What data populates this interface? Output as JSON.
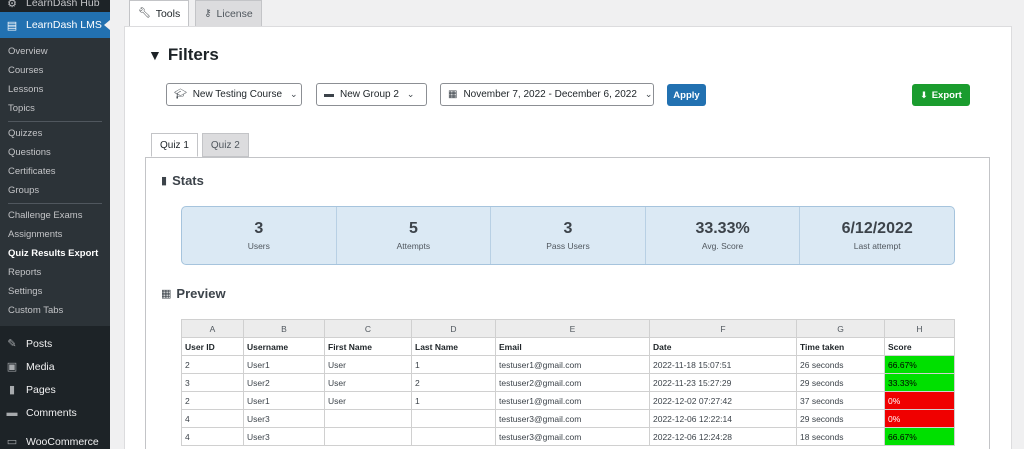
{
  "sidebar": {
    "hub_label": "LearnDash Hub",
    "current_label": "LearnDash LMS",
    "submenu": [
      {
        "label": "Overview"
      },
      {
        "label": "Courses"
      },
      {
        "label": "Lessons"
      },
      {
        "label": "Topics"
      },
      {
        "label": "Quizzes"
      },
      {
        "label": "Questions"
      },
      {
        "label": "Certificates"
      },
      {
        "label": "Groups"
      },
      {
        "label": "Challenge Exams"
      },
      {
        "label": "Assignments"
      },
      {
        "label": "Quiz Results Export"
      },
      {
        "label": "Reports"
      },
      {
        "label": "Settings"
      },
      {
        "label": "Custom Tabs"
      }
    ],
    "main_items": [
      {
        "label": "Posts"
      },
      {
        "label": "Media"
      },
      {
        "label": "Pages"
      },
      {
        "label": "Comments"
      },
      {
        "label": "WooCommerce"
      }
    ]
  },
  "top_tabs": [
    {
      "label": "Tools"
    },
    {
      "label": "License"
    }
  ],
  "filters": {
    "title": "Filters",
    "course": "New Testing Course",
    "group": "New Group 2",
    "date_range": "November 7, 2022 - December 6, 2022",
    "apply_label": "Apply",
    "export_label": "Export"
  },
  "quiz_tabs": [
    {
      "label": "Quiz 1"
    },
    {
      "label": "Quiz 2"
    }
  ],
  "stats": {
    "title": "Stats",
    "items": [
      {
        "value": "3",
        "label": "Users"
      },
      {
        "value": "5",
        "label": "Attempts"
      },
      {
        "value": "3",
        "label": "Pass Users"
      },
      {
        "value": "33.33%",
        "label": "Avg. Score"
      },
      {
        "value": "6/12/2022",
        "label": "Last attempt"
      }
    ]
  },
  "preview": {
    "title": "Preview",
    "column_letters": [
      "A",
      "B",
      "C",
      "D",
      "E",
      "F",
      "G",
      "H"
    ],
    "headers": [
      "User ID",
      "Username",
      "First Name",
      "Last Name",
      "Email",
      "Date",
      "Time taken",
      "Score"
    ],
    "rows": [
      [
        "2",
        "User1",
        "User",
        "1",
        "testuser1@gmail.com",
        "2022-11-18 15:07:51",
        "26 seconds",
        "66.67%"
      ],
      [
        "3",
        "User2",
        "User",
        "2",
        "testuser2@gmail.com",
        "2022-11-23 15:27:29",
        "29 seconds",
        "33.33%"
      ],
      [
        "2",
        "User1",
        "User",
        "1",
        "testuser1@gmail.com",
        "2022-12-02 07:27:42",
        "37 seconds",
        "0%"
      ],
      [
        "4",
        "User3",
        "",
        "",
        "testuser3@gmail.com",
        "2022-12-06 12:22:14",
        "29 seconds",
        "0%"
      ],
      [
        "4",
        "User3",
        "",
        "",
        "testuser3@gmail.com",
        "2022-12-06 12:24:28",
        "18 seconds",
        "66.67%"
      ]
    ],
    "score_colors": {
      "pass": "#00e000",
      "fail": "#f00000"
    }
  }
}
